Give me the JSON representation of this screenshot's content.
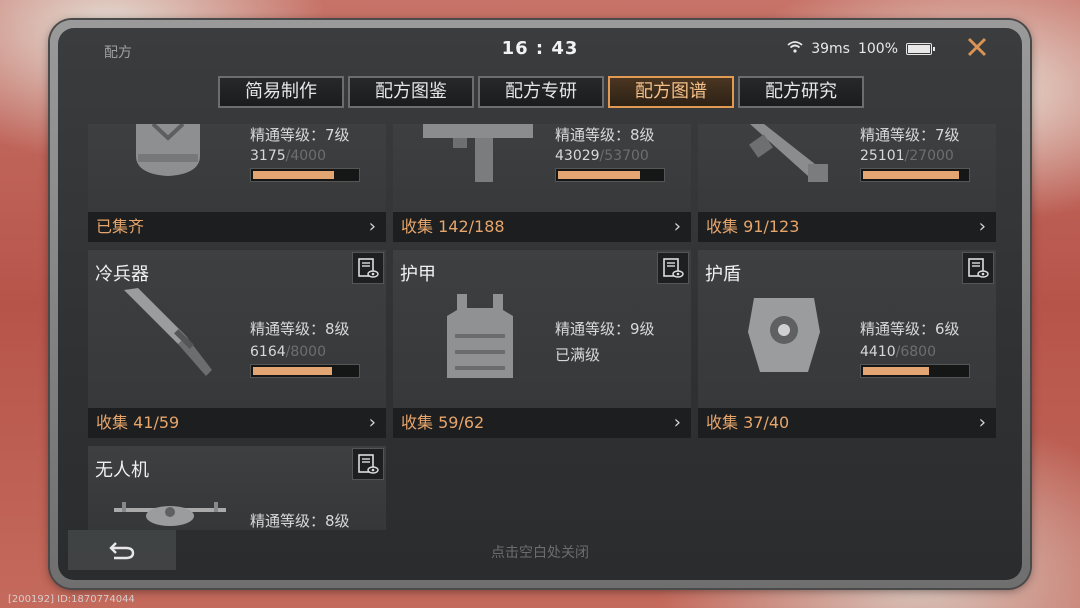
{
  "status": {
    "title": "配方",
    "time": "16 : 43",
    "ping": "39ms",
    "battery": "100%"
  },
  "tabs": [
    {
      "label": "简易制作"
    },
    {
      "label": "配方图鉴"
    },
    {
      "label": "配方专研"
    },
    {
      "label": "配方图谱",
      "active": true
    },
    {
      "label": "配方研究"
    }
  ],
  "cards": {
    "helmet": {
      "level": "精通等级：7级",
      "progress": "3175",
      "max": "/4000",
      "fill_pct": 79,
      "collect": "已集齐"
    },
    "smg": {
      "level": "精通等级：8级",
      "progress": "43029",
      "max": "/53700",
      "fill_pct": 80,
      "collect": "收集 142/188"
    },
    "launcher": {
      "level": "精通等级：7级",
      "progress": "25101",
      "max": "/27000",
      "fill_pct": 93,
      "collect": "收集 91/123"
    },
    "melee": {
      "name": "冷兵器",
      "level": "精通等级：8级",
      "progress": "6164",
      "max": "/8000",
      "fill_pct": 77,
      "collect": "收集 41/59"
    },
    "armor": {
      "name": "护甲",
      "level": "精通等级：9级",
      "maxed": "已满级",
      "collect": "收集 59/62"
    },
    "shield": {
      "name": "护盾",
      "level": "精通等级：6级",
      "progress": "4410",
      "max": "/6800",
      "fill_pct": 65,
      "collect": "收集 37/40"
    },
    "drone": {
      "name": "无人机",
      "level": "精通等级：8级"
    }
  },
  "hint": "点击空白处关闭",
  "footer_id": "[200192] ID:1870774044",
  "colors": {
    "accent": "#e09a54",
    "collect_text": "#e6a56b",
    "bar_fill": "#e3a673"
  }
}
